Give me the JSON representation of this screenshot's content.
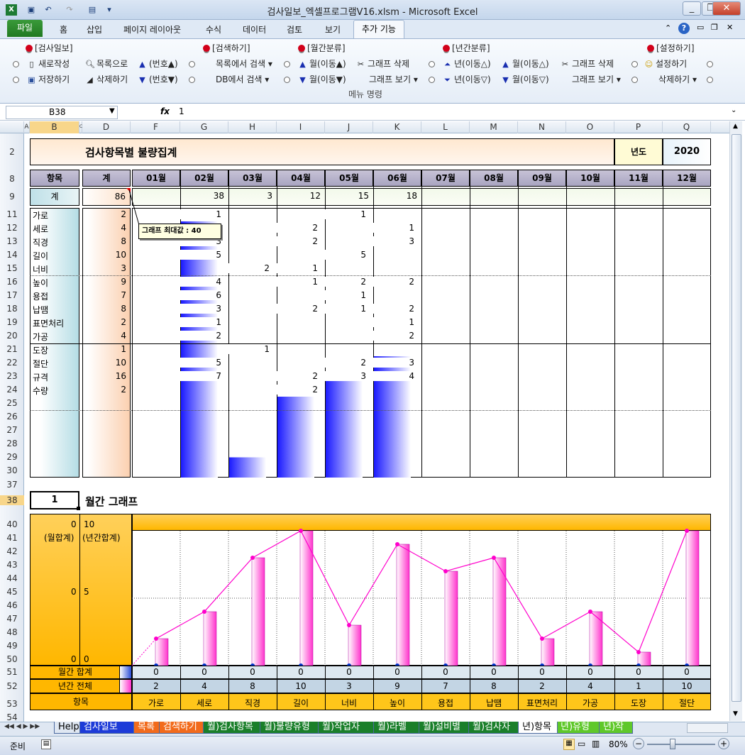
{
  "window": {
    "title": "검사일보_엑셀프로그램V16.xlsm  -  Microsoft Excel"
  },
  "tabs": [
    {
      "label": "파일"
    },
    {
      "label": "홈"
    },
    {
      "label": "삽입"
    },
    {
      "label": "페이지 레이아웃"
    },
    {
      "label": "수식"
    },
    {
      "label": "데이터"
    },
    {
      "label": "검토"
    },
    {
      "label": "보기"
    },
    {
      "label": "추가 기능"
    }
  ],
  "ribbon": {
    "g1": "[검사일보]",
    "new": "새로작성",
    "save": "저장하기",
    "tolist": "목록으로",
    "delete": "삭제하기",
    "numup": "(번호▲)",
    "numdown": "(번호▼)",
    "g2": "[검색하기]",
    "searchlist": "목록에서 검색",
    "searchdb": "DB에서 검색",
    "g3": "[월간분류]",
    "mup": "월(이동▲)",
    "mdown": "월(이동▼)",
    "gdel": "그래프 삭제",
    "gview": "그래프 보기",
    "g4": "[년간분류]",
    "yup": "년(이동△)",
    "ydown": "년(이동▽)",
    "mup2": "월(이동△)",
    "mdown2": "월(이동▽)",
    "gdel2": "그래프 삭제",
    "gview2": "그래프 보기",
    "g5": "[설정하기]",
    "setting": "설정하기",
    "delete2": "삭제하기",
    "group_label": "메뉴 명령"
  },
  "formula": {
    "namebox": "B38",
    "fx": "fx",
    "value": "1"
  },
  "columns": [
    "A",
    "B",
    "C",
    "D",
    "F",
    "G",
    "H",
    "I",
    "J",
    "K",
    "L",
    "M",
    "N",
    "O",
    "P",
    "Q"
  ],
  "sheet": {
    "title": "검사항목별 불량집계",
    "year_label": "년도",
    "year": "2020",
    "hdr_item": "항목",
    "hdr_total": "계",
    "months": [
      "01월",
      "02월",
      "03월",
      "04월",
      "05월",
      "06월",
      "07월",
      "08월",
      "09월",
      "10월",
      "11월",
      "12월"
    ],
    "total_label": "계",
    "grand_total": "86",
    "month_totals": [
      "",
      "38",
      "3",
      "12",
      "15",
      "18",
      "",
      "",
      "",
      "",
      "",
      ""
    ],
    "rows": [
      {
        "r": "11",
        "name": "가로",
        "total": "2",
        "v": [
          "",
          "1",
          "",
          "",
          "1",
          "",
          "",
          "",
          "",
          "",
          "",
          ""
        ]
      },
      {
        "r": "12",
        "name": "세로",
        "total": "4",
        "v": [
          "",
          "",
          "",
          "2",
          "",
          "1",
          "",
          "",
          "",
          "",
          "",
          ""
        ]
      },
      {
        "r": "13",
        "name": "직경",
        "total": "8",
        "v": [
          "",
          "3",
          "",
          "2",
          "",
          "3",
          "",
          "",
          "",
          "",
          "",
          ""
        ]
      },
      {
        "r": "14",
        "name": "길이",
        "total": "10",
        "v": [
          "",
          "5",
          "",
          "",
          "5",
          "",
          "",
          "",
          "",
          "",
          "",
          ""
        ]
      },
      {
        "r": "15",
        "name": "너비",
        "total": "3",
        "v": [
          "",
          "",
          "2",
          "1",
          "",
          "",
          "",
          "",
          "",
          "",
          "",
          ""
        ]
      },
      {
        "r": "16",
        "name": "높이",
        "total": "9",
        "v": [
          "",
          "4",
          "",
          "1",
          "2",
          "2",
          "",
          "",
          "",
          "",
          "",
          ""
        ]
      },
      {
        "r": "17",
        "name": "용접",
        "total": "7",
        "v": [
          "",
          "6",
          "",
          "",
          "1",
          "",
          "",
          "",
          "",
          "",
          "",
          ""
        ]
      },
      {
        "r": "18",
        "name": "납땜",
        "total": "8",
        "v": [
          "",
          "3",
          "",
          "2",
          "1",
          "2",
          "",
          "",
          "",
          "",
          "",
          ""
        ]
      },
      {
        "r": "19",
        "name": "표면처리",
        "total": "2",
        "v": [
          "",
          "1",
          "",
          "",
          "",
          "1",
          "",
          "",
          "",
          "",
          "",
          ""
        ]
      },
      {
        "r": "20",
        "name": "가공",
        "total": "4",
        "v": [
          "",
          "2",
          "",
          "",
          "",
          "2",
          "",
          "",
          "",
          "",
          "",
          ""
        ]
      },
      {
        "r": "21",
        "name": "도장",
        "total": "1",
        "v": [
          "",
          "",
          "1",
          "",
          "",
          "",
          "",
          "",
          "",
          "",
          "",
          ""
        ]
      },
      {
        "r": "22",
        "name": "절단",
        "total": "10",
        "v": [
          "",
          "5",
          "",
          "",
          "2",
          "3",
          "",
          "",
          "",
          "",
          "",
          ""
        ]
      },
      {
        "r": "23",
        "name": "규격",
        "total": "16",
        "v": [
          "",
          "7",
          "",
          "2",
          "3",
          "4",
          "",
          "",
          "",
          "",
          "",
          ""
        ]
      },
      {
        "r": "24",
        "name": "수량",
        "total": "2",
        "v": [
          "",
          "",
          "",
          "2",
          "",
          "",
          "",
          "",
          "",
          "",
          "",
          ""
        ]
      },
      {
        "r": "25",
        "name": "",
        "total": "",
        "v": [
          "",
          "",
          "",
          "",
          "",
          "",
          "",
          "",
          "",
          "",
          "",
          ""
        ]
      },
      {
        "r": "26",
        "name": "",
        "total": "",
        "v": [
          "",
          "",
          "",
          "",
          "",
          "",
          "",
          "",
          "",
          "",
          "",
          ""
        ]
      },
      {
        "r": "27",
        "name": "",
        "total": "",
        "v": [
          "",
          "",
          "",
          "",
          "",
          "",
          "",
          "",
          "",
          "",
          "",
          ""
        ]
      },
      {
        "r": "28",
        "name": "",
        "total": "",
        "v": [
          "",
          "",
          "",
          "",
          "",
          "",
          "",
          "",
          "",
          "",
          "",
          ""
        ]
      },
      {
        "r": "29",
        "name": "",
        "total": "",
        "v": [
          "",
          "",
          "",
          "",
          "",
          "",
          "",
          "",
          "",
          "",
          "",
          ""
        ]
      },
      {
        "r": "30",
        "name": "",
        "total": "",
        "v": [
          "",
          "",
          "",
          "",
          "",
          "",
          "",
          "",
          "",
          "",
          "",
          ""
        ]
      }
    ],
    "comment": "그래프 최대값 : 40",
    "monthly_index": "1",
    "monthly_graph_title": "월간 그래프",
    "axis_left": {
      "top": "0",
      "mid": "0",
      "bottom": "0",
      "label": "(월합계)"
    },
    "axis_right": {
      "top": "10",
      "mid": "5",
      "bottom": "0",
      "label": "(년간합계)"
    },
    "row51_label": "월간 합계",
    "row52_label": "년간 전체",
    "row53_label": "항목",
    "monthly_sum": [
      "0",
      "0",
      "0",
      "0",
      "0",
      "0",
      "0",
      "0",
      "0",
      "0",
      "0",
      "0"
    ],
    "yearly_total": [
      "2",
      "4",
      "8",
      "10",
      "3",
      "9",
      "7",
      "8",
      "2",
      "4",
      "1",
      "10"
    ],
    "items": [
      "가로",
      "세로",
      "직경",
      "길이",
      "너비",
      "높이",
      "용접",
      "납땜",
      "표면처리",
      "가공",
      "도장",
      "절단"
    ]
  },
  "chart_data": [
    {
      "type": "bar",
      "title": "",
      "categories": [
        "01월",
        "02월",
        "03월",
        "04월",
        "05월",
        "06월",
        "07월",
        "08월",
        "09월",
        "10월",
        "11월",
        "12월"
      ],
      "values": [
        0,
        38,
        3,
        12,
        15,
        18,
        0,
        0,
        0,
        0,
        0,
        0
      ],
      "ylim": [
        0,
        40
      ],
      "colors": [
        "#1a1aff"
      ]
    },
    {
      "type": "bar",
      "title": "월간 그래프",
      "categories": [
        "가로",
        "세로",
        "직경",
        "길이",
        "너비",
        "높이",
        "용접",
        "납땜",
        "표면처리",
        "가공",
        "도장",
        "절단"
      ],
      "series": [
        {
          "name": "(년간합계)",
          "values": [
            2,
            4,
            8,
            10,
            3,
            9,
            7,
            8,
            2,
            4,
            1,
            10
          ]
        },
        {
          "name": "(월합계)",
          "values": [
            0,
            0,
            0,
            0,
            0,
            0,
            0,
            0,
            0,
            0,
            0,
            0
          ]
        }
      ],
      "ylim": [
        0,
        10
      ],
      "colors": [
        "#ff33cc",
        "#ff00cc",
        "#0033cc"
      ]
    }
  ],
  "sheet_tabs": [
    "Help",
    "검사일보",
    "목록",
    "검색하기",
    "월)검사항목",
    "월)불량유형",
    "월)작업자",
    "월)라벨",
    "월)설비별",
    "월)검사자",
    "년)항목",
    "년)유형",
    "년)작"
  ],
  "status": {
    "ready": "준비",
    "zoom": "80%"
  }
}
